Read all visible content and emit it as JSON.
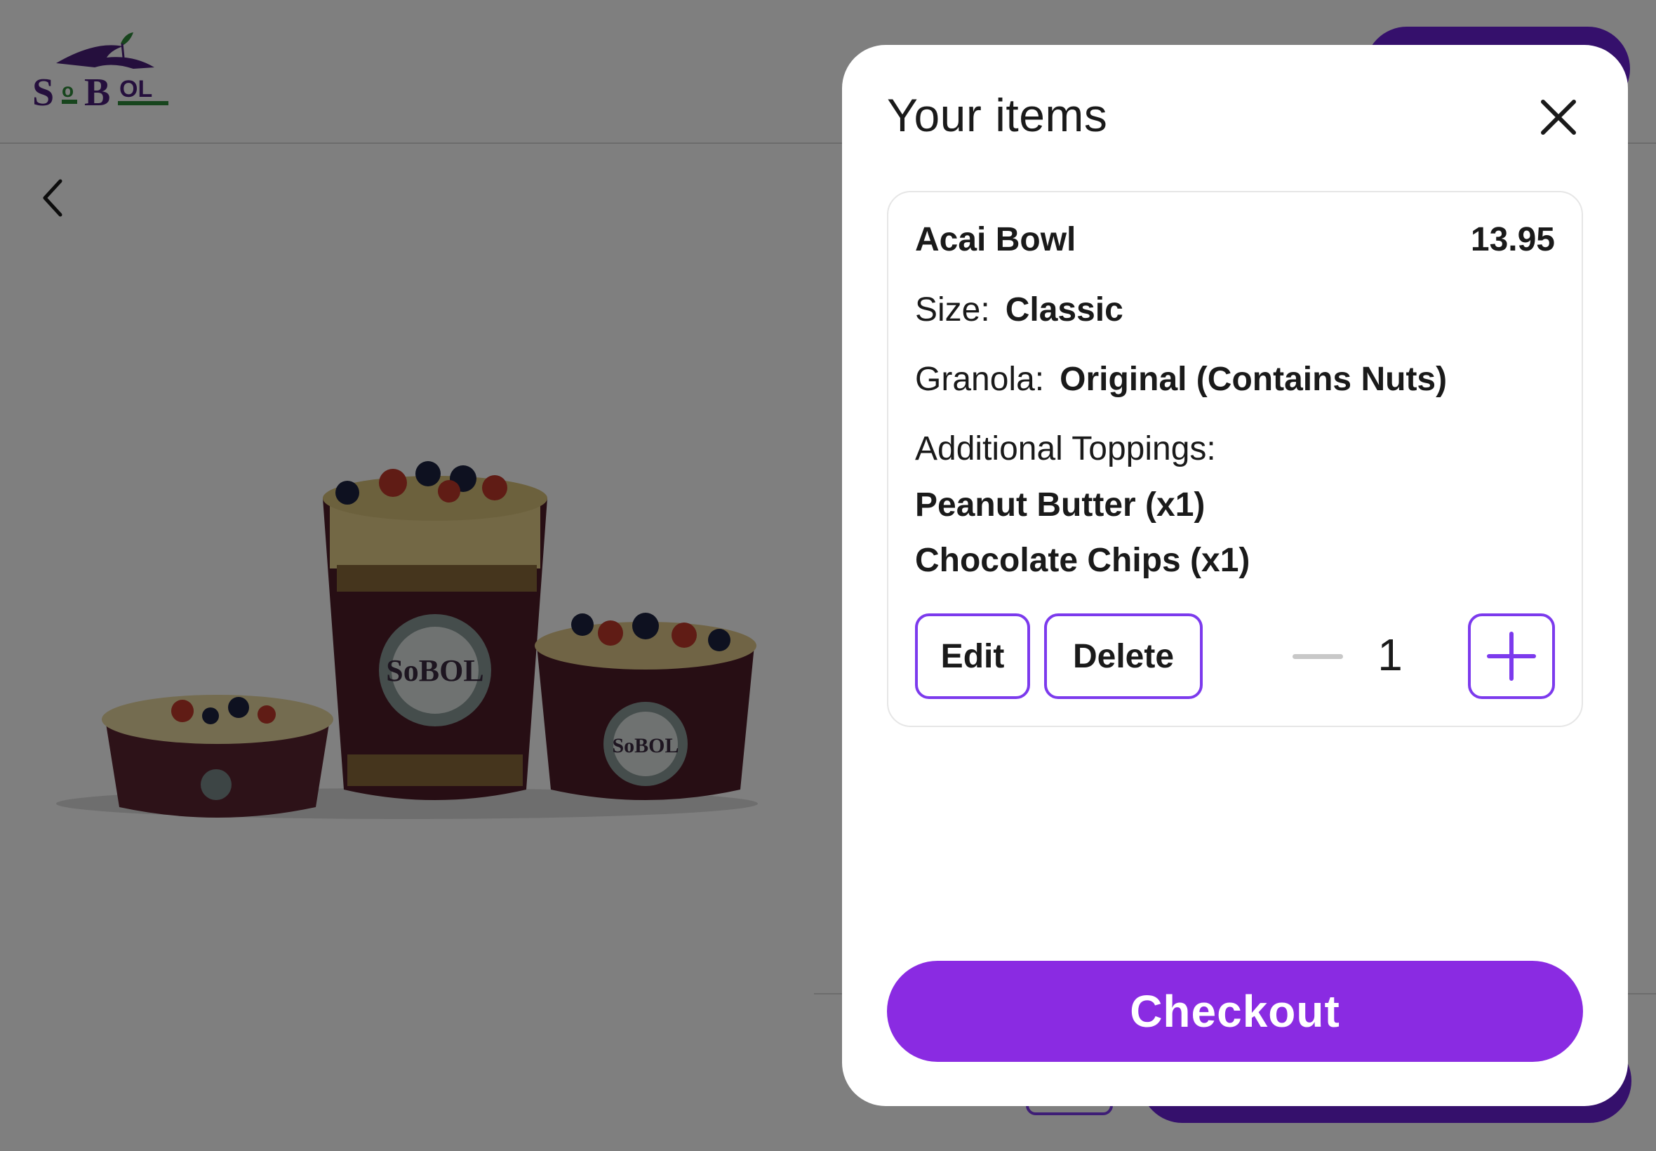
{
  "brand": {
    "logo_text": "SoBOL",
    "colors": {
      "accent": "#8a2be2",
      "accent_outline": "#7c3aed",
      "logo_purple": "#4b1f7a",
      "logo_green": "#2e8b3a"
    }
  },
  "background": {
    "back_icon": "chevron-left-icon",
    "hero_image": "acai-bowls-photo"
  },
  "cart": {
    "title": "Your items",
    "close_icon": "close-icon",
    "item": {
      "name": "Acai Bowl",
      "price": "13.95",
      "options": [
        {
          "label": "Size:",
          "value": "Classic"
        },
        {
          "label": "Granola:",
          "value": "Original (Contains Nuts)"
        }
      ],
      "toppings_label": "Additional Toppings:",
      "toppings": [
        "Peanut Butter (x1)",
        "Chocolate Chips (x1)"
      ],
      "edit_label": "Edit",
      "delete_label": "Delete",
      "quantity": "1",
      "minus_icon": "minus-icon",
      "plus_icon": "plus-icon"
    },
    "checkout_label": "Checkout"
  }
}
